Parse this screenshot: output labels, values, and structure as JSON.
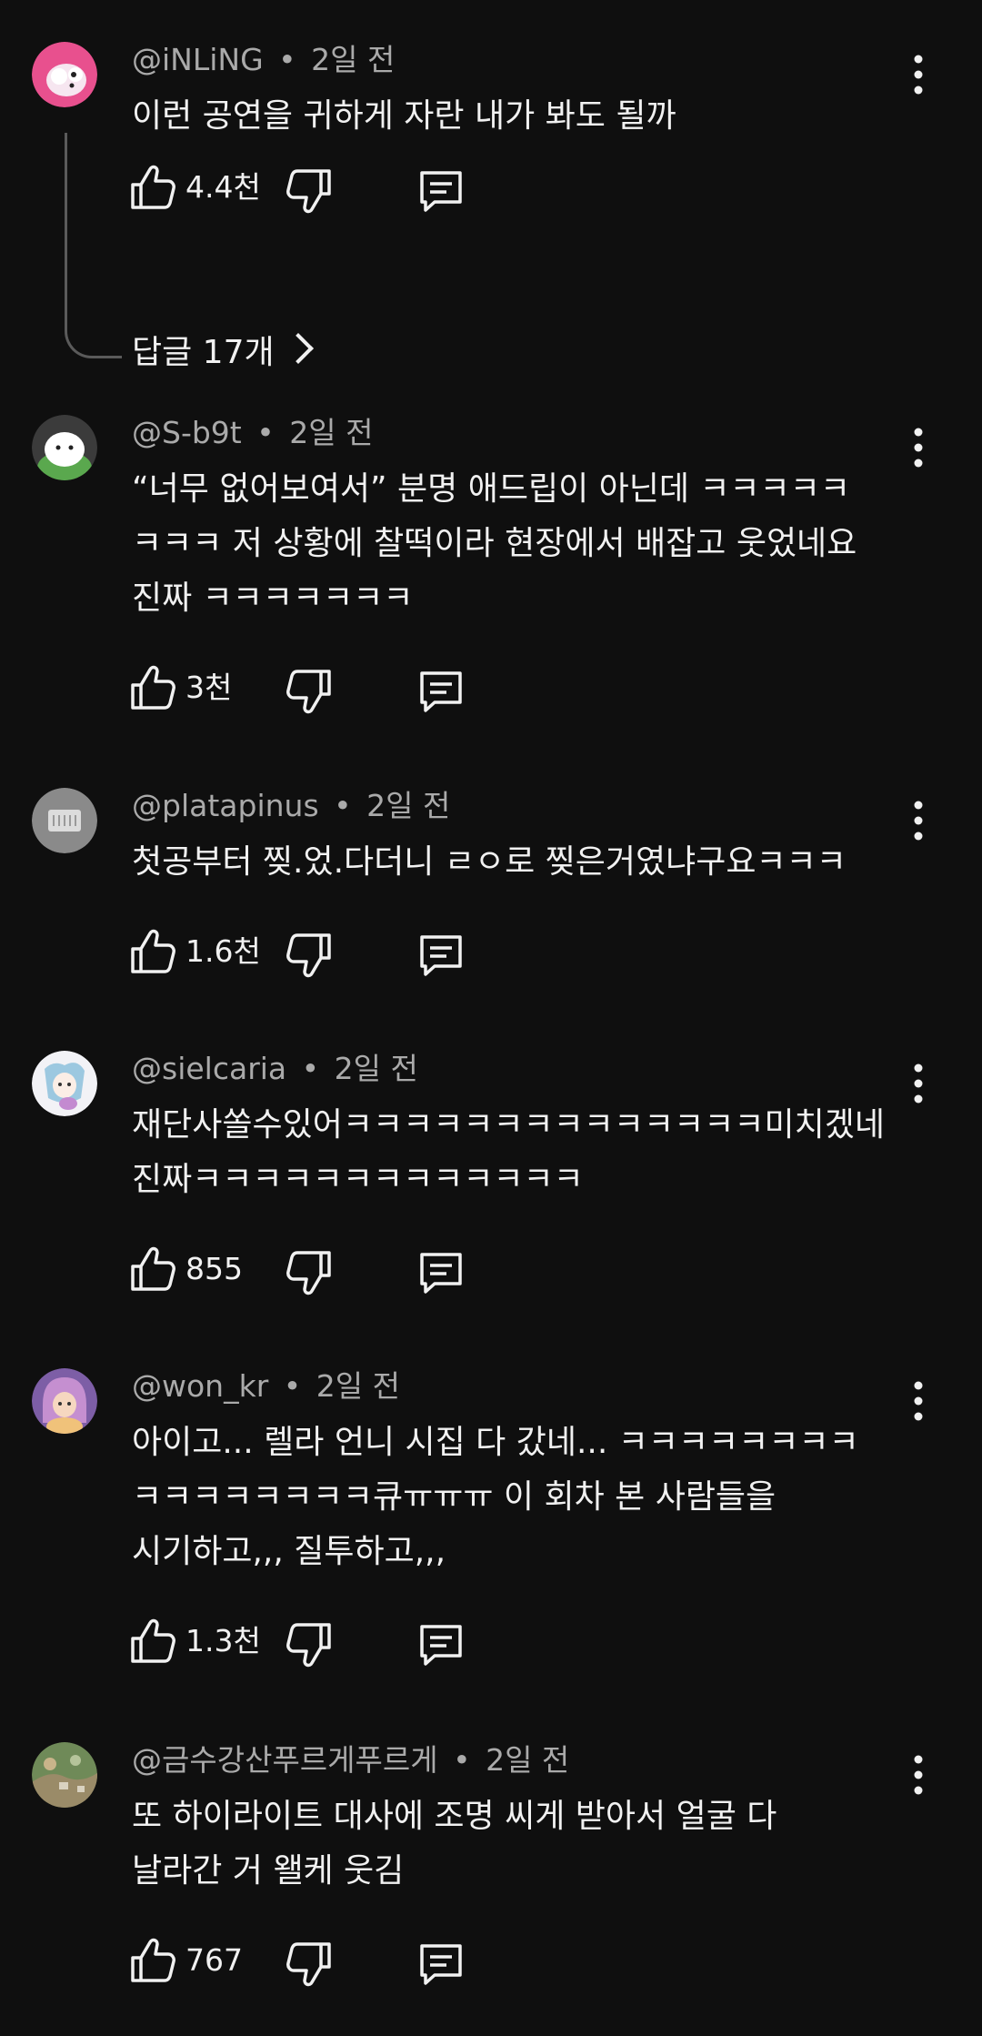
{
  "comments": [
    {
      "handle": "@iNLiNG",
      "separator": "•",
      "time": "2일 전",
      "text": "이런 공연을 귀하게 자란 내가 봐도 될까",
      "likes": "4.4천",
      "replies_label": "답글 17개",
      "avatar_colors": [
        "#e8508e",
        "#ffffff"
      ]
    },
    {
      "handle": "@S-b9t",
      "separator": "•",
      "time": "2일 전",
      "text": "“너무 없어보여서” 분명 애드립이 아닌데 ㅋㅋㅋㅋㅋ\nㅋㅋㅋ 저 상황에 찰떡이라 현장에서 배잡고 웃었네요\n진짜 ㅋㅋㅋㅋㅋㅋㅋ",
      "likes": "3천",
      "avatar_colors": [
        "#5aa84e",
        "#ffffff"
      ]
    },
    {
      "handle": "@platapinus",
      "separator": "•",
      "time": "2일 전",
      "text": "첫공부터 찢.었.다더니 ㄹㅇ로 찢은거였냐구요ㅋㅋㅋ",
      "likes": "1.6천",
      "avatar_colors": [
        "#8a8a8a",
        "#dcdcdc"
      ]
    },
    {
      "handle": "@sielcaria",
      "separator": "•",
      "time": "2일 전",
      "text": "재단사쏠수있어ㅋㅋㅋㅋㅋㅋㅋㅋㅋㅋㅋㅋㅋㅋ미치겠네\n진짜ㅋㅋㅋㅋㅋㅋㅋㅋㅋㅋㅋㅋㅋ",
      "likes": "855",
      "avatar_colors": [
        "#e6e6ef",
        "#7fb6d6"
      ]
    },
    {
      "handle": "@won_kr",
      "separator": "•",
      "time": "2일 전",
      "text": "아이고... 렐라 언니 시집 다 갔네... ㅋㅋㅋㅋㅋㅋㅋㅋ\nㅋㅋㅋㅋㅋㅋㅋㅋ큐ㅠㅠㅠ 이 회차 본 사람들을\n시기하고,,, 질투하고,,,",
      "likes": "1.3천",
      "avatar_colors": [
        "#c58fd0",
        "#f0c27a"
      ]
    },
    {
      "handle": "@금수강산푸르게푸르게",
      "separator": "•",
      "time": "2일 전",
      "text": "또 하이라이트 대사에 조명 씨게 받아서 얼굴 다\n날라간 거 왤케 웃김",
      "likes": "767",
      "avatar_colors": [
        "#6f8a58",
        "#c9b48a"
      ]
    }
  ],
  "icons": {
    "like": "thumbs-up-icon",
    "dislike": "thumbs-down-icon",
    "reply": "reply-comment-icon",
    "more": "more-vertical-icon"
  },
  "colors": {
    "background": "#0f0f0f",
    "text": "#f1f1f1",
    "meta": "#aaaaaa"
  }
}
